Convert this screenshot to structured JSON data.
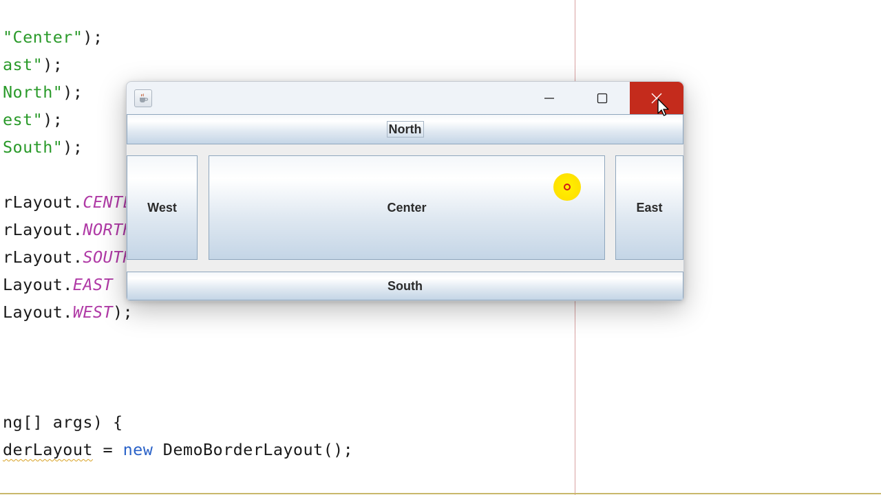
{
  "editor": {
    "lines": [
      {
        "segments": [
          {
            "t": "\"Center\"",
            "c": "str"
          },
          {
            "t": ");",
            "c": ""
          }
        ]
      },
      {
        "segments": [
          {
            "t": "ast\"",
            "c": "str"
          },
          {
            "t": ");",
            "c": ""
          }
        ]
      },
      {
        "segments": [
          {
            "t": "North\"",
            "c": "str"
          },
          {
            "t": ");",
            "c": ""
          }
        ]
      },
      {
        "segments": [
          {
            "t": "est\"",
            "c": "str"
          },
          {
            "t": ");",
            "c": ""
          }
        ]
      },
      {
        "segments": [
          {
            "t": "South\"",
            "c": "str"
          },
          {
            "t": ");",
            "c": ""
          }
        ]
      },
      {
        "segments": []
      },
      {
        "segments": [
          {
            "t": "rLayout.",
            "c": ""
          },
          {
            "t": "CENTER",
            "c": "field"
          }
        ]
      },
      {
        "segments": [
          {
            "t": "rLayout.",
            "c": ""
          },
          {
            "t": "NORTH",
            "c": "field"
          }
        ]
      },
      {
        "segments": [
          {
            "t": "rLayout.",
            "c": ""
          },
          {
            "t": "SOUTH",
            "c": "field"
          }
        ]
      },
      {
        "segments": [
          {
            "t": "Layout.",
            "c": ""
          },
          {
            "t": "EAST",
            "c": "field"
          }
        ]
      },
      {
        "segments": [
          {
            "t": "Layout.",
            "c": ""
          },
          {
            "t": "WEST",
            "c": "field"
          },
          {
            "t": ");",
            "c": ""
          }
        ]
      },
      {
        "segments": []
      },
      {
        "segments": []
      },
      {
        "segments": []
      },
      {
        "segments": [
          {
            "t": "ng[] args) {",
            "c": ""
          }
        ]
      },
      {
        "segments": [
          {
            "t": "derLayout",
            "c": "squiggle"
          },
          {
            "t": " = ",
            "c": ""
          },
          {
            "t": "new",
            "c": "kw"
          },
          {
            "t": " DemoBorderLayout();",
            "c": ""
          }
        ]
      }
    ]
  },
  "window": {
    "title": "",
    "buttons": {
      "north": "North",
      "west": "West",
      "center": "Center",
      "east": "East",
      "south": "South"
    }
  },
  "colors": {
    "close_hover": "#c42b1c",
    "string": "#2a9a2a",
    "field": "#b03aa6",
    "keyword": "#2a62c8"
  }
}
